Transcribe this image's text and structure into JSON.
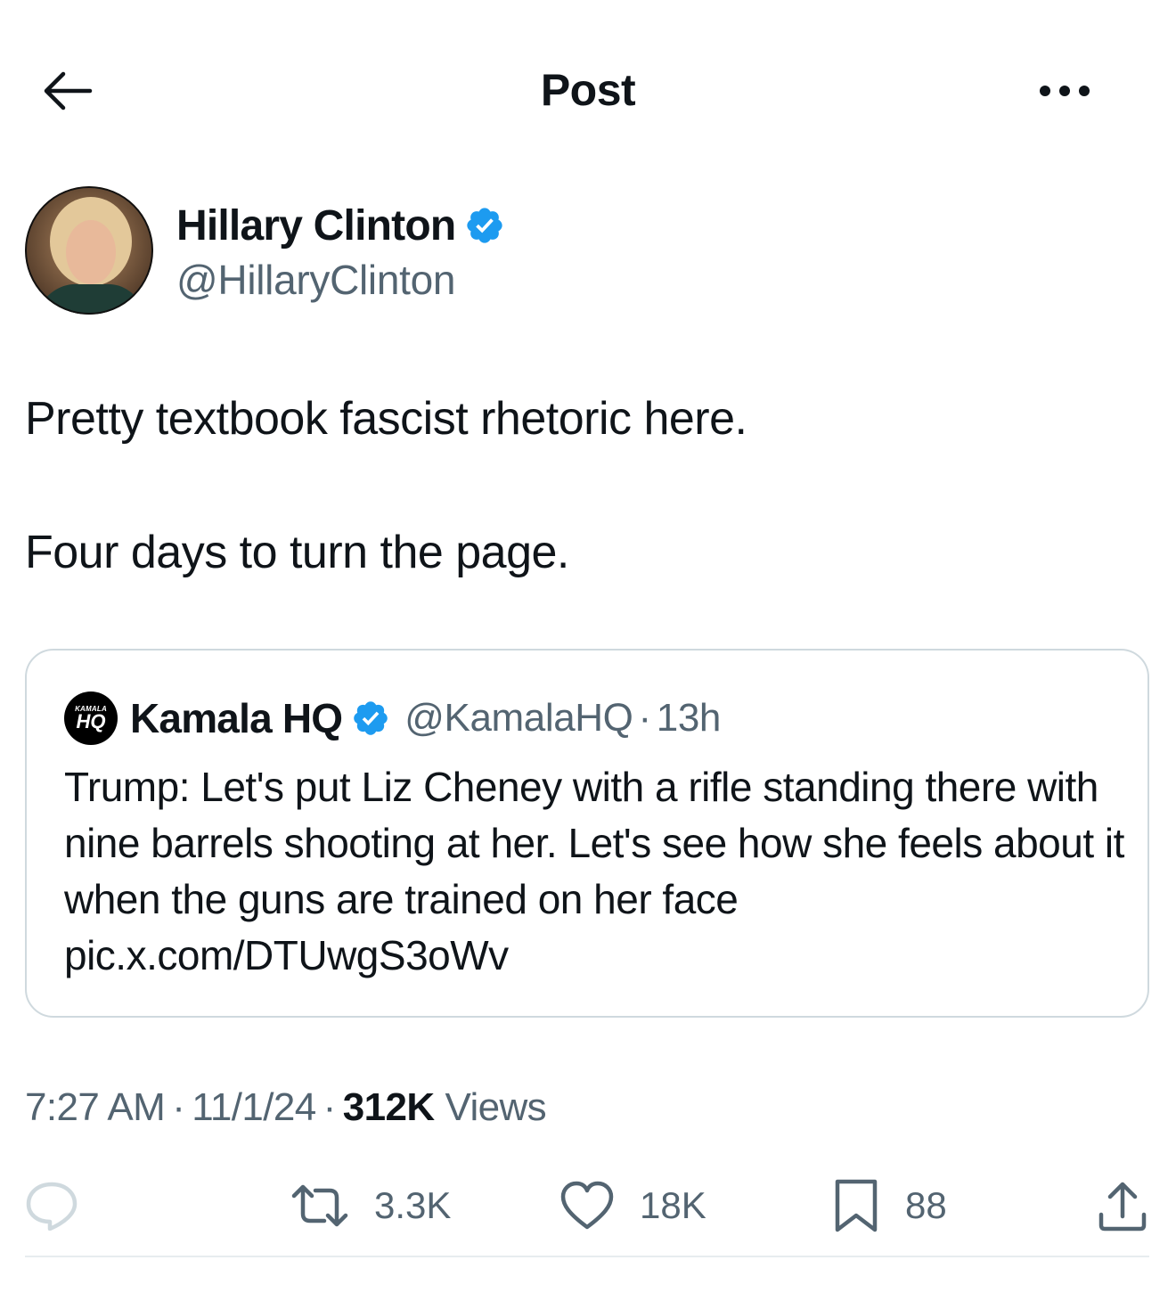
{
  "header": {
    "title": "Post",
    "back_icon": "arrow-left-icon",
    "more_icon": "more-horizontal-icon"
  },
  "author": {
    "name": "Hillary Clinton",
    "handle": "@HillaryClinton",
    "verified": true,
    "verified_color": "#1d9bf0"
  },
  "post": {
    "line_1": "Pretty textbook fascist rhetoric here.",
    "line_2": "Four days to turn the page."
  },
  "quote": {
    "avatar_small_text": "KAMALA",
    "avatar_big_text": "HQ",
    "name": "Kamala HQ",
    "handle": "@KamalaHQ",
    "separator": "·",
    "time": "13h",
    "text": "Trump: Let's put Liz Cheney with a rifle standing there with nine barrels shooting at her. Let's see how she feels about it when the guns are trained on her face pic.x.com/DTUwgS3oWv"
  },
  "meta": {
    "time": "7:27 AM",
    "date": "11/1/24",
    "separator": "·",
    "views_count": "312K",
    "views_label": "Views"
  },
  "actions": {
    "reply": {
      "icon": "reply-icon",
      "count": ""
    },
    "retweet": {
      "icon": "retweet-icon",
      "count": "3.3K"
    },
    "like": {
      "icon": "heart-icon",
      "count": "18K"
    },
    "bookmark": {
      "icon": "bookmark-icon",
      "count": "88"
    },
    "share": {
      "icon": "share-icon"
    }
  },
  "colors": {
    "text_primary": "#0f1419",
    "text_secondary": "#536471",
    "border": "#cfd9de",
    "verified": "#1d9bf0",
    "reply_icon": "#cfd9de"
  }
}
